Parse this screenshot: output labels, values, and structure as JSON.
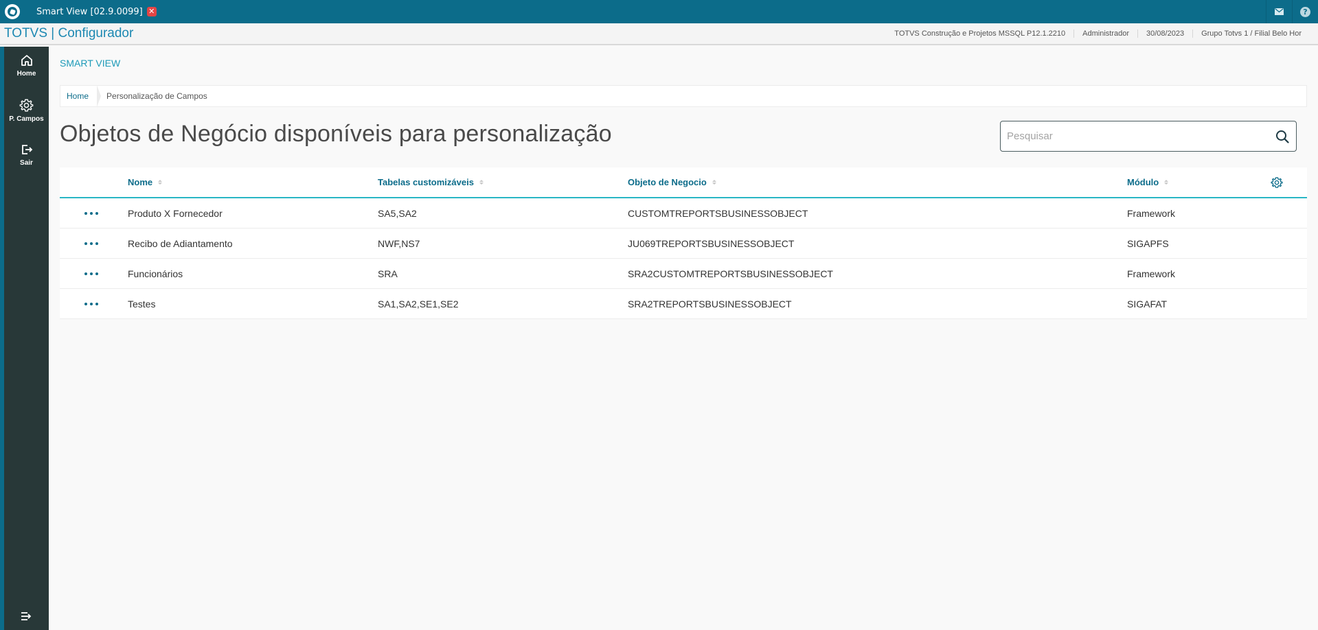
{
  "window": {
    "tab_title": "Smart View [02.9.0099]",
    "close_icon": "close-icon",
    "mail_icon": "mail-icon",
    "help_label": "?"
  },
  "header": {
    "app_title": "TOTVS | Configurador",
    "company": "TOTVS Construção e Projetos MSSQL P12.1.2210",
    "user": "Administrador",
    "date": "30/08/2023",
    "branch": "Grupo Totvs 1 / Filial Belo Hor"
  },
  "sidebar": {
    "items": [
      {
        "label": "Home",
        "icon": "home-icon"
      },
      {
        "label": "P. Campos",
        "icon": "gear-icon"
      },
      {
        "label": "Sair",
        "icon": "logout-icon"
      }
    ],
    "collapse_icon": "collapse-menu-icon"
  },
  "main": {
    "section_title": "SMART VIEW",
    "breadcrumb": {
      "home": "Home",
      "current": "Personalização de Campos"
    },
    "page_title": "Objetos de Negócio disponíveis para personalização",
    "search": {
      "placeholder": "Pesquisar",
      "value": ""
    },
    "table": {
      "columns": [
        "Nome",
        "Tabelas customizáveis",
        "Objeto de Negocio",
        "Módulo"
      ],
      "rows": [
        {
          "nome": "Produto X Fornecedor",
          "tabelas": "SA5,SA2",
          "objeto": "CUSTOMTREPORTSBUSINESSOBJECT",
          "modulo": "Framework"
        },
        {
          "nome": "Recibo de Adiantamento",
          "tabelas": "NWF,NS7",
          "objeto": "JU069TREPORTSBUSINESSOBJECT",
          "modulo": "SIGAPFS"
        },
        {
          "nome": "Funcionários",
          "tabelas": "SRA",
          "objeto": "SRA2CUSTOMTREPORTSBUSINESSOBJECT",
          "modulo": "Framework"
        },
        {
          "nome": "Testes",
          "tabelas": "SA1,SA2,SE1,SE2",
          "objeto": "SRA2TREPORTSBUSINESSOBJECT",
          "modulo": "SIGAFAT"
        }
      ]
    }
  },
  "colors": {
    "topbar": "#0c6c8a",
    "sidebar": "#283838",
    "accent": "#1c9ab8",
    "table_underline": "#29b6c5"
  }
}
